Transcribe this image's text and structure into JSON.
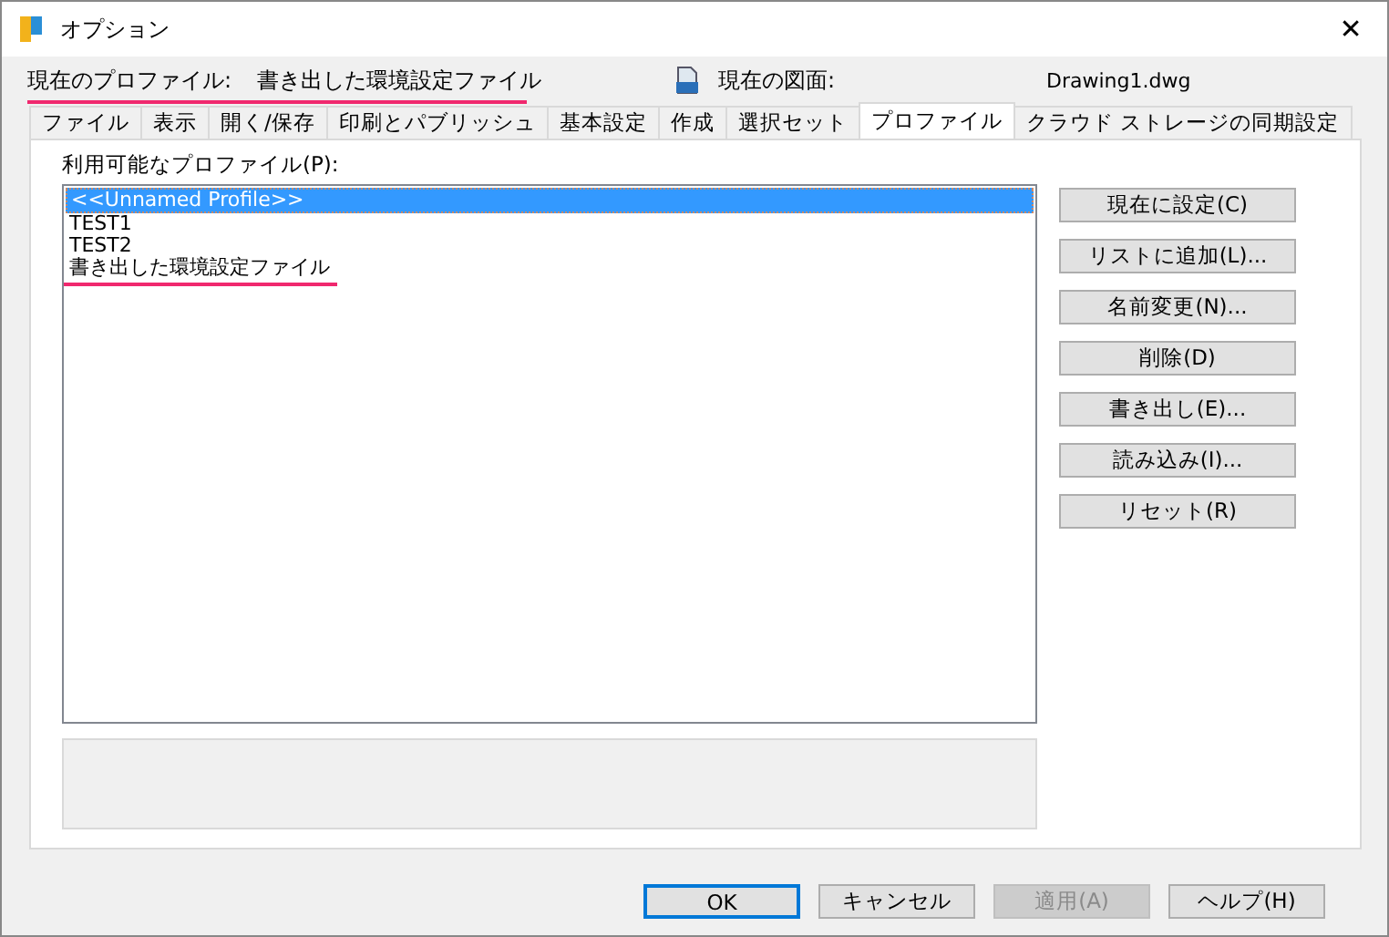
{
  "window": {
    "title": "オプション",
    "close": "✕"
  },
  "current_profile": {
    "label": "現在のプロファイル:",
    "value": "書き出した環境設定ファイル",
    "underlined": true
  },
  "current_drawing": {
    "label": "現在の図面:",
    "value": "Drawing1.dwg"
  },
  "tabs": [
    {
      "label": "ファイル",
      "selected": false
    },
    {
      "label": "表示",
      "selected": false
    },
    {
      "label": "開く/保存",
      "selected": false
    },
    {
      "label": "印刷とパブリッシュ",
      "selected": false
    },
    {
      "label": "基本設定",
      "selected": false
    },
    {
      "label": "作成",
      "selected": false
    },
    {
      "label": "選択セット",
      "selected": false
    },
    {
      "label": "プロファイル",
      "selected": true
    },
    {
      "label": "クラウド ストレージの同期設定",
      "selected": false
    }
  ],
  "profiles": {
    "label": "利用可能なプロファイル(P):",
    "items": [
      {
        "label": "<<Unnamed Profile>>",
        "selected": true,
        "underlined": false
      },
      {
        "label": "TEST1",
        "selected": false,
        "underlined": false
      },
      {
        "label": "TEST2",
        "selected": false,
        "underlined": false
      },
      {
        "label": "書き出した環境設定ファイル",
        "selected": false,
        "underlined": true
      }
    ]
  },
  "side_buttons": [
    {
      "label": "現在に設定(C)",
      "disabled": false
    },
    {
      "label": "リストに追加(L)...",
      "disabled": false
    },
    {
      "label": "名前変更(N)...",
      "disabled": false
    },
    {
      "label": "削除(D)",
      "disabled": false
    },
    {
      "label": "書き出し(E)...",
      "disabled": false
    },
    {
      "label": "読み込み(I)...",
      "disabled": false
    },
    {
      "label": "リセット(R)",
      "disabled": false
    }
  ],
  "footer_buttons": [
    {
      "label": "OK",
      "disabled": false,
      "default": true
    },
    {
      "label": "キャンセル",
      "disabled": false,
      "default": false
    },
    {
      "label": "適用(A)",
      "disabled": true,
      "default": false
    },
    {
      "label": "ヘルプ(H)",
      "disabled": false,
      "default": false
    }
  ]
}
